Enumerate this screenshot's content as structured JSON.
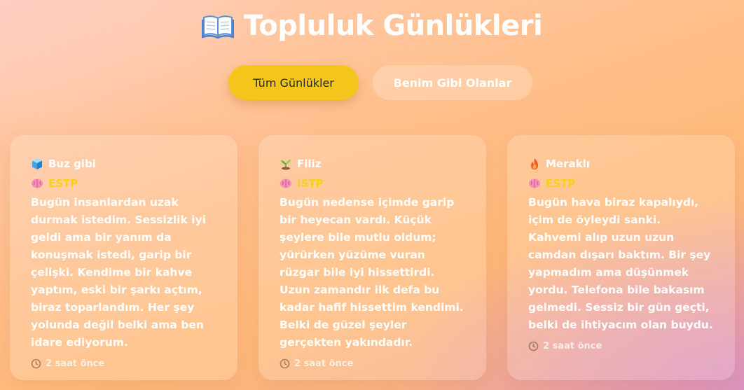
{
  "header": {
    "title": "Topluluk Günlükleri",
    "icon": "open-book-icon"
  },
  "tabs": [
    {
      "label": "Tüm Günlükler",
      "active": true
    },
    {
      "label": "Benim Gibi Olanlar",
      "active": false
    }
  ],
  "colors": {
    "accent": "#f5c51c",
    "type_text": "#f7d01b"
  },
  "entries": [
    {
      "mood_icon": "ice-cube-icon",
      "mood": "Buz gibi",
      "type_icon": "brain-icon",
      "type": "ESTP",
      "text": "Bugün insanlardan uzak durmak istedim. Sessizlik iyi geldi ama bir yanım da konuşmak istedi, garip bir çelişki. Kendime bir kahve yaptım, eski bir şarkı açtım, biraz toparlandım. Her şey yolunda değil belki ama ben idare ediyorum.",
      "time_icon": "clock-icon",
      "time": "2 saat önce"
    },
    {
      "mood_icon": "seedling-icon",
      "mood": "Filiz",
      "type_icon": "brain-icon",
      "type": "ISTP",
      "text": "Bugün nedense içimde garip bir heyecan vardı. Küçük şeylere bile mutlu oldum; yürürken yüzüme vuran rüzgar bile iyi hissettirdi. Uzun zamandır ilk defa bu kadar hafif hissettim kendimi. Belki de güzel şeyler gerçekten yakındadır.",
      "time_icon": "clock-icon",
      "time": "2 saat önce"
    },
    {
      "mood_icon": "fire-icon",
      "mood": "Meraklı",
      "type_icon": "brain-icon",
      "type": "ESTP",
      "text": "Bugün hava biraz kapalıydı, içim de öyleydi sanki. Kahvemi alıp uzun uzun camdan dışarı baktım. Bir şey yapmadım ama düşünmek yordu. Telefona bile bakasım gelmedi. Sessiz bir gün geçti, belki de ihtiyacım olan buydu.",
      "time_icon": "clock-icon",
      "time": "2 saat önce"
    }
  ]
}
